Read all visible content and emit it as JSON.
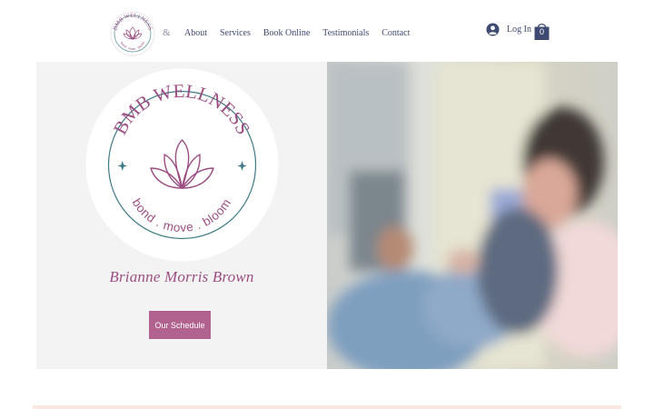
{
  "header": {
    "logo_alt": "BMB WELLNESS",
    "logo_tagline": "bond . move . bloom",
    "amp": "&",
    "nav": [
      {
        "label": "About"
      },
      {
        "label": "Services"
      },
      {
        "label": "Book Online"
      },
      {
        "label": "Testimonials"
      },
      {
        "label": "Contact"
      }
    ],
    "login_label": "Log In",
    "cart_count": "0",
    "icons": {
      "login": "user-avatar-icon",
      "cart": "shopping-bag-icon"
    }
  },
  "hero": {
    "badge_title": "BMB WELLNESS",
    "badge_tagline": "bond . move . bloom",
    "person_name": "Brianne Morris Brown",
    "cta_label": "Our Schedule"
  },
  "colors": {
    "brand_magenta": "#9c4f83",
    "button": "#b2628f",
    "nav_text": "#3f4a73",
    "ring": "#3c7a86",
    "panel_bg": "#f3f3f3"
  }
}
